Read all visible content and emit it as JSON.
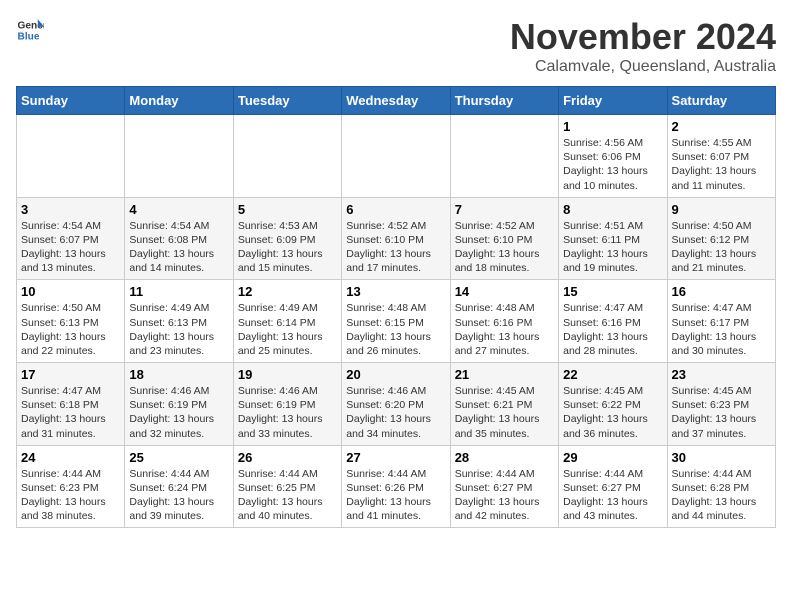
{
  "logo": {
    "text_general": "General",
    "text_blue": "Blue"
  },
  "title": "November 2024",
  "location": "Calamvale, Queensland, Australia",
  "days_of_week": [
    "Sunday",
    "Monday",
    "Tuesday",
    "Wednesday",
    "Thursday",
    "Friday",
    "Saturday"
  ],
  "weeks": [
    {
      "days": [
        {
          "date": "",
          "info": ""
        },
        {
          "date": "",
          "info": ""
        },
        {
          "date": "",
          "info": ""
        },
        {
          "date": "",
          "info": ""
        },
        {
          "date": "",
          "info": ""
        },
        {
          "date": "1",
          "info": "Sunrise: 4:56 AM\nSunset: 6:06 PM\nDaylight: 13 hours\nand 10 minutes."
        },
        {
          "date": "2",
          "info": "Sunrise: 4:55 AM\nSunset: 6:07 PM\nDaylight: 13 hours\nand 11 minutes."
        }
      ]
    },
    {
      "days": [
        {
          "date": "3",
          "info": "Sunrise: 4:54 AM\nSunset: 6:07 PM\nDaylight: 13 hours\nand 13 minutes."
        },
        {
          "date": "4",
          "info": "Sunrise: 4:54 AM\nSunset: 6:08 PM\nDaylight: 13 hours\nand 14 minutes."
        },
        {
          "date": "5",
          "info": "Sunrise: 4:53 AM\nSunset: 6:09 PM\nDaylight: 13 hours\nand 15 minutes."
        },
        {
          "date": "6",
          "info": "Sunrise: 4:52 AM\nSunset: 6:10 PM\nDaylight: 13 hours\nand 17 minutes."
        },
        {
          "date": "7",
          "info": "Sunrise: 4:52 AM\nSunset: 6:10 PM\nDaylight: 13 hours\nand 18 minutes."
        },
        {
          "date": "8",
          "info": "Sunrise: 4:51 AM\nSunset: 6:11 PM\nDaylight: 13 hours\nand 19 minutes."
        },
        {
          "date": "9",
          "info": "Sunrise: 4:50 AM\nSunset: 6:12 PM\nDaylight: 13 hours\nand 21 minutes."
        }
      ]
    },
    {
      "days": [
        {
          "date": "10",
          "info": "Sunrise: 4:50 AM\nSunset: 6:13 PM\nDaylight: 13 hours\nand 22 minutes."
        },
        {
          "date": "11",
          "info": "Sunrise: 4:49 AM\nSunset: 6:13 PM\nDaylight: 13 hours\nand 23 minutes."
        },
        {
          "date": "12",
          "info": "Sunrise: 4:49 AM\nSunset: 6:14 PM\nDaylight: 13 hours\nand 25 minutes."
        },
        {
          "date": "13",
          "info": "Sunrise: 4:48 AM\nSunset: 6:15 PM\nDaylight: 13 hours\nand 26 minutes."
        },
        {
          "date": "14",
          "info": "Sunrise: 4:48 AM\nSunset: 6:16 PM\nDaylight: 13 hours\nand 27 minutes."
        },
        {
          "date": "15",
          "info": "Sunrise: 4:47 AM\nSunset: 6:16 PM\nDaylight: 13 hours\nand 28 minutes."
        },
        {
          "date": "16",
          "info": "Sunrise: 4:47 AM\nSunset: 6:17 PM\nDaylight: 13 hours\nand 30 minutes."
        }
      ]
    },
    {
      "days": [
        {
          "date": "17",
          "info": "Sunrise: 4:47 AM\nSunset: 6:18 PM\nDaylight: 13 hours\nand 31 minutes."
        },
        {
          "date": "18",
          "info": "Sunrise: 4:46 AM\nSunset: 6:19 PM\nDaylight: 13 hours\nand 32 minutes."
        },
        {
          "date": "19",
          "info": "Sunrise: 4:46 AM\nSunset: 6:19 PM\nDaylight: 13 hours\nand 33 minutes."
        },
        {
          "date": "20",
          "info": "Sunrise: 4:46 AM\nSunset: 6:20 PM\nDaylight: 13 hours\nand 34 minutes."
        },
        {
          "date": "21",
          "info": "Sunrise: 4:45 AM\nSunset: 6:21 PM\nDaylight: 13 hours\nand 35 minutes."
        },
        {
          "date": "22",
          "info": "Sunrise: 4:45 AM\nSunset: 6:22 PM\nDaylight: 13 hours\nand 36 minutes."
        },
        {
          "date": "23",
          "info": "Sunrise: 4:45 AM\nSunset: 6:23 PM\nDaylight: 13 hours\nand 37 minutes."
        }
      ]
    },
    {
      "days": [
        {
          "date": "24",
          "info": "Sunrise: 4:44 AM\nSunset: 6:23 PM\nDaylight: 13 hours\nand 38 minutes."
        },
        {
          "date": "25",
          "info": "Sunrise: 4:44 AM\nSunset: 6:24 PM\nDaylight: 13 hours\nand 39 minutes."
        },
        {
          "date": "26",
          "info": "Sunrise: 4:44 AM\nSunset: 6:25 PM\nDaylight: 13 hours\nand 40 minutes."
        },
        {
          "date": "27",
          "info": "Sunrise: 4:44 AM\nSunset: 6:26 PM\nDaylight: 13 hours\nand 41 minutes."
        },
        {
          "date": "28",
          "info": "Sunrise: 4:44 AM\nSunset: 6:27 PM\nDaylight: 13 hours\nand 42 minutes."
        },
        {
          "date": "29",
          "info": "Sunrise: 4:44 AM\nSunset: 6:27 PM\nDaylight: 13 hours\nand 43 minutes."
        },
        {
          "date": "30",
          "info": "Sunrise: 4:44 AM\nSunset: 6:28 PM\nDaylight: 13 hours\nand 44 minutes."
        }
      ]
    }
  ]
}
